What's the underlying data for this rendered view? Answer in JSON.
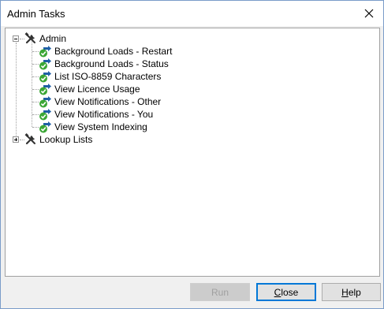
{
  "window": {
    "title": "Admin Tasks"
  },
  "tree": {
    "groups": [
      {
        "label": "Admin",
        "expanded": true,
        "children": [
          "Background Loads - Restart",
          "Background Loads - Status",
          "List ISO-8859 Characters",
          "View Licence Usage",
          "View Notifications - Other",
          "View Notifications - You",
          "View System Indexing"
        ]
      },
      {
        "label": "Lookup Lists",
        "expanded": false,
        "children": []
      }
    ]
  },
  "buttons": {
    "run": "Run",
    "close_first": "C",
    "close_rest": "lose",
    "help_first": "H",
    "help_rest": "elp"
  },
  "colors": {
    "focus_border": "#0078d7",
    "task_check_green": "#3aa635",
    "task_arrow_blue": "#1f5fa6"
  }
}
